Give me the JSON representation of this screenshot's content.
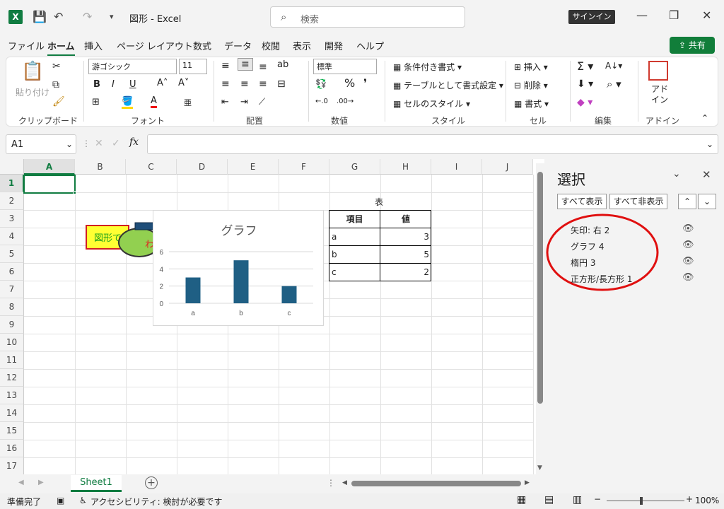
{
  "app": {
    "title": "図形 - Excel",
    "logo": "X"
  },
  "search": {
    "placeholder": "検索"
  },
  "signin": "サインイン",
  "menu": [
    "ファイル",
    "ホーム",
    "挿入",
    "ページ レイアウト",
    "数式",
    "データ",
    "校閲",
    "表示",
    "開発",
    "ヘルプ"
  ],
  "share": "共有",
  "ribbon": {
    "clipboard": {
      "paste": "貼り付け",
      "label": "クリップボード"
    },
    "font": {
      "name": "游ゴシック",
      "size": "11",
      "label": "フォント",
      "bold": "B",
      "italic": "I",
      "underline": "U"
    },
    "align": {
      "label": "配置"
    },
    "number": {
      "format": "標準",
      "label": "数値"
    },
    "style": {
      "cond": "条件付き書式",
      "table": "テーブルとして書式設定",
      "cell": "セルのスタイル",
      "label": "スタイル"
    },
    "cells": {
      "insert": "挿入",
      "delete": "削除",
      "format": "書式",
      "label": "セル"
    },
    "edit": {
      "label": "編集"
    },
    "addin": {
      "btn": "アド\nイン",
      "label": "アドイン"
    }
  },
  "formula": {
    "namebox": "A1",
    "fx": "fx",
    "value": ""
  },
  "columns": [
    "A",
    "B",
    "C",
    "D",
    "E",
    "F",
    "G",
    "H",
    "I",
    "J"
  ],
  "rows": [
    "1",
    "2",
    "3",
    "4",
    "5",
    "6",
    "7",
    "8",
    "9",
    "10",
    "11",
    "12",
    "13",
    "14",
    "15",
    "16",
    "17"
  ],
  "shapes": {
    "rect_text": "図形で",
    "ellipse_text": "わ"
  },
  "table": {
    "title": "表",
    "headers": [
      "項目",
      "値"
    ],
    "rows": [
      [
        "a",
        "3"
      ],
      [
        "b",
        "5"
      ],
      [
        "c",
        "2"
      ]
    ]
  },
  "chart_data": {
    "type": "bar",
    "title": "グラフ",
    "categories": [
      "a",
      "b",
      "c"
    ],
    "values": [
      3,
      5,
      2
    ],
    "ylim": [
      0,
      6
    ],
    "yticks": [
      "0",
      "2",
      "4",
      "6"
    ],
    "color": "#1f5f84",
    "grid": true
  },
  "sheet_tab": "Sheet1",
  "status": {
    "ready": "準備完了",
    "accessibility": "アクセシビリティ: 検討が必要です",
    "zoom": "100%"
  },
  "pane": {
    "title": "選択",
    "show_all": "すべて表示",
    "hide_all": "すべて非表示",
    "items": [
      "矢印: 右 2",
      "グラフ 4",
      "楕円 3",
      "正方形/長方形 1"
    ]
  }
}
